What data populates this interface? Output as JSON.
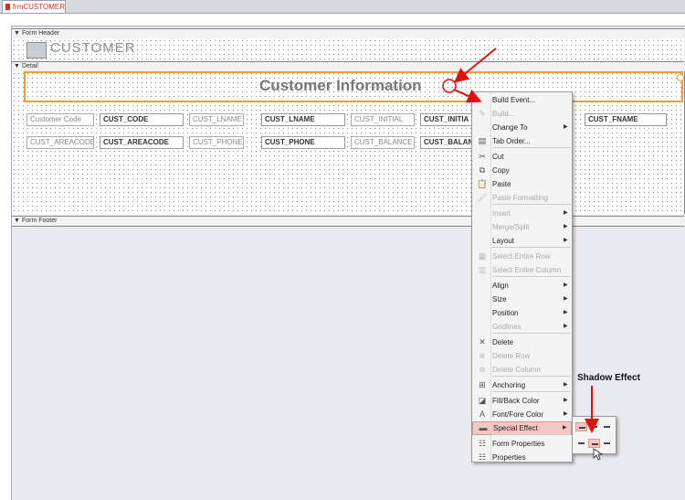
{
  "tab": {
    "title": "frmCUSTOMER"
  },
  "sections": {
    "header": "Form Header",
    "detail": "Detail",
    "footer": "Form Footer"
  },
  "form_title": "CUSTOMER",
  "detail_title": "Customer Information",
  "row1": [
    "Customer Code",
    "CUST_CODE",
    "CUST_LNAME",
    "CUST_LNAME",
    "CUST_INITIAL",
    "CUST_INITIA",
    "CUST_FNAME"
  ],
  "row2": [
    "CUST_AREACODE",
    "CUST_AREACODE",
    "CUST_PHONE",
    "CUST_PHONE",
    "CUST_BALANCE",
    "CUST_BALAN"
  ],
  "context_menu": [
    {
      "label": "Build Event...",
      "icon": "build-event-icon",
      "enabled": true
    },
    {
      "label": "Build...",
      "icon": "build-icon",
      "enabled": false
    },
    {
      "label": "Change To",
      "icon": "",
      "enabled": true,
      "submenu": true
    },
    {
      "label": "Tab Order...",
      "icon": "tab-order-icon",
      "enabled": true
    },
    {
      "label": "Cut",
      "icon": "cut-icon",
      "enabled": true
    },
    {
      "label": "Copy",
      "icon": "copy-icon",
      "enabled": true
    },
    {
      "label": "Paste",
      "icon": "paste-icon",
      "enabled": true
    },
    {
      "label": "Paste Formatting",
      "icon": "paste-formatting-icon",
      "enabled": false
    },
    {
      "label": "Insert",
      "icon": "",
      "enabled": false,
      "submenu": true
    },
    {
      "label": "Merge/Split",
      "icon": "",
      "enabled": false,
      "submenu": true
    },
    {
      "label": "Layout",
      "icon": "",
      "enabled": true,
      "submenu": true
    },
    {
      "label": "Select Entire Row",
      "icon": "select-row-icon",
      "enabled": false
    },
    {
      "label": "Select Entire Column",
      "icon": "select-column-icon",
      "enabled": false
    },
    {
      "label": "Align",
      "icon": "",
      "enabled": true,
      "submenu": true
    },
    {
      "label": "Size",
      "icon": "",
      "enabled": true,
      "submenu": true
    },
    {
      "label": "Position",
      "icon": "",
      "enabled": true,
      "submenu": true
    },
    {
      "label": "Gridlines",
      "icon": "",
      "enabled": false,
      "submenu": true
    },
    {
      "label": "Delete",
      "icon": "delete-icon",
      "enabled": true
    },
    {
      "label": "Delete Row",
      "icon": "delete-row-icon",
      "enabled": false
    },
    {
      "label": "Delete Column",
      "icon": "delete-column-icon",
      "enabled": false
    },
    {
      "label": "Anchoring",
      "icon": "anchoring-icon",
      "enabled": true,
      "submenu": true
    },
    {
      "label": "Fill/Back Color",
      "icon": "fill-color-icon",
      "enabled": true,
      "submenu": true
    },
    {
      "label": "Font/Fore Color",
      "icon": "font-color-icon",
      "enabled": true,
      "submenu": true
    },
    {
      "label": "Special Effect",
      "icon": "special-effect-icon",
      "enabled": true,
      "submenu": true,
      "highlighted": true
    },
    {
      "label": "Form Properties",
      "icon": "form-properties-icon",
      "enabled": true
    },
    {
      "label": "Properties",
      "icon": "properties-icon",
      "enabled": true
    }
  ],
  "annotation": "Shadow Effect",
  "colors": {
    "accent": "#c0392b",
    "highlight": "#f5c6c6",
    "arrow": "#e01010"
  }
}
